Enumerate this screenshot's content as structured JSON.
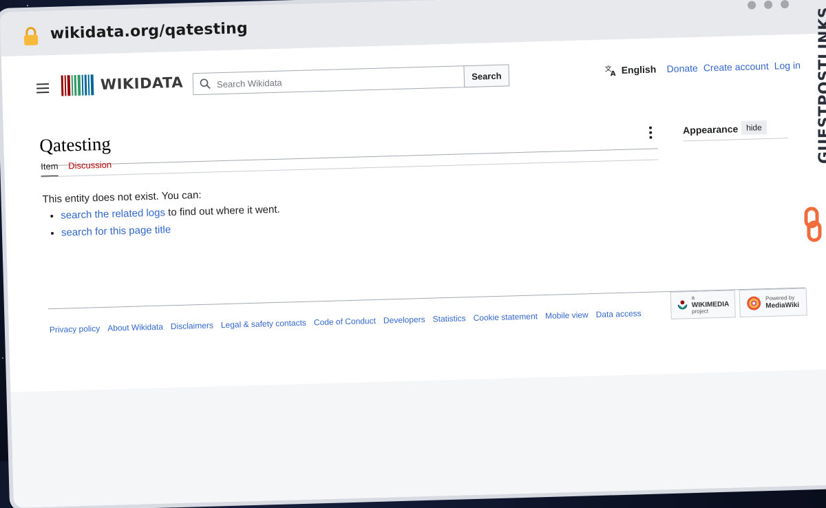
{
  "browser": {
    "url": "wikidata.org/qatesting"
  },
  "header": {
    "logo_text": "WIKIDATA",
    "search_placeholder": "Search Wikidata",
    "search_button": "Search",
    "language": "English",
    "links": [
      "Donate",
      "Create account",
      "Log in"
    ]
  },
  "page": {
    "title": "Qatesting",
    "tabs": [
      "Item",
      "Discussion"
    ],
    "message": "This entity does not exist. You can:",
    "suggestions": [
      {
        "link": "search the related logs",
        "rest": " to find out where it went."
      },
      {
        "link": "search for this page title",
        "rest": ""
      }
    ]
  },
  "sidebar": {
    "appearance_label": "Appearance",
    "hide_label": "hide"
  },
  "footer": {
    "links": [
      "Privacy policy",
      "About Wikidata",
      "Disclaimers",
      "Legal & safety contacts",
      "Code of Conduct",
      "Developers",
      "Statistics",
      "Cookie statement",
      "Mobile view",
      "Data access"
    ],
    "wikimedia_badge": {
      "small": "a",
      "big": "WIKIMEDIA",
      "small2": "project"
    },
    "mediawiki_badge": {
      "small": "Powered by",
      "big": "MediaWiki"
    }
  },
  "watermark": {
    "text": "GUESTPOSTLINKS"
  },
  "colors": {
    "link": "#3366cc",
    "discussion_tab": "#ba0000",
    "watermark_orange": "#f26b3a"
  }
}
